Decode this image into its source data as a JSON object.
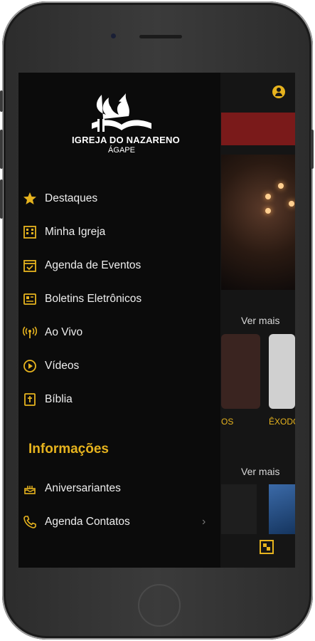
{
  "logo": {
    "name": "IGREJA DO NAZARENO",
    "subtitle": "ÁGAPE"
  },
  "menu": [
    {
      "label": "Destaques",
      "icon": "star-icon"
    },
    {
      "label": "Minha Igreja",
      "icon": "building-icon"
    },
    {
      "label": "Agenda de Eventos",
      "icon": "calendar-icon"
    },
    {
      "label": "Boletins Eletrônicos",
      "icon": "newspaper-icon"
    },
    {
      "label": "Ao Vivo",
      "icon": "broadcast-icon"
    },
    {
      "label": "Vídeos",
      "icon": "play-icon"
    },
    {
      "label": "Bíblia",
      "icon": "bible-icon"
    }
  ],
  "info_section": {
    "title": "Informações",
    "items": [
      {
        "label": "Aniversariantes",
        "icon": "cake-icon"
      },
      {
        "label": "Agenda Contatos",
        "icon": "phone-icon"
      }
    ]
  },
  "background": {
    "see_more_1": "Ver mais",
    "see_more_2": "Ver mais",
    "card_title_1": "OS",
    "card_title_2": "ÊXODO"
  },
  "colors": {
    "accent": "#e6b31e",
    "drawer_bg": "#0b0b0b",
    "text": "#eeeeee"
  }
}
